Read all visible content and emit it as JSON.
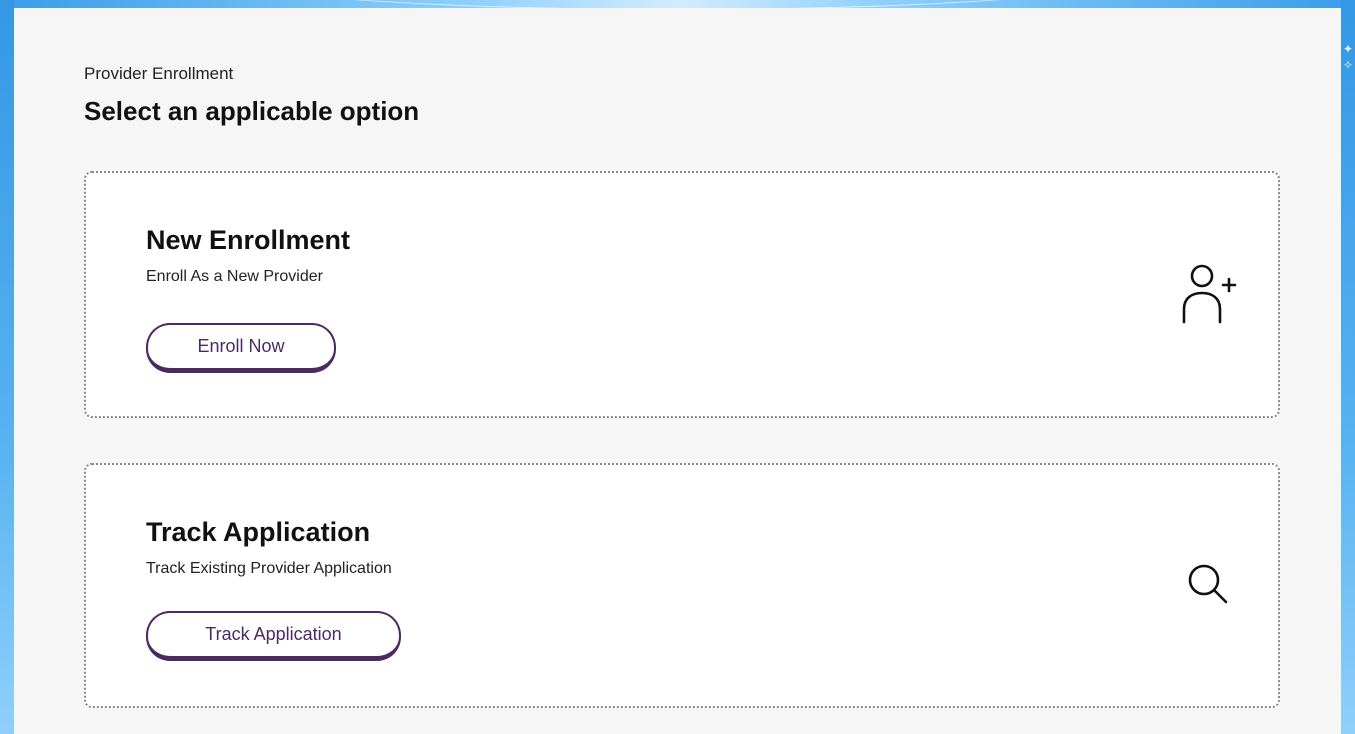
{
  "page": {
    "eyebrow": "Provider Enrollment",
    "heading": "Select an applicable option"
  },
  "cards": [
    {
      "title": "New Enrollment",
      "subtitle": "Enroll As a New Provider",
      "button_label": "Enroll Now",
      "icon": "add-user-icon"
    },
    {
      "title": "Track Application",
      "subtitle": "Track Existing Provider Application",
      "button_label": "Track Application",
      "icon": "search-icon"
    }
  ],
  "colors": {
    "frame": "#2f93e6",
    "panel_bg": "#f6f6f6",
    "card_bg": "#ffffff",
    "button_accent": "#4b2a63"
  }
}
